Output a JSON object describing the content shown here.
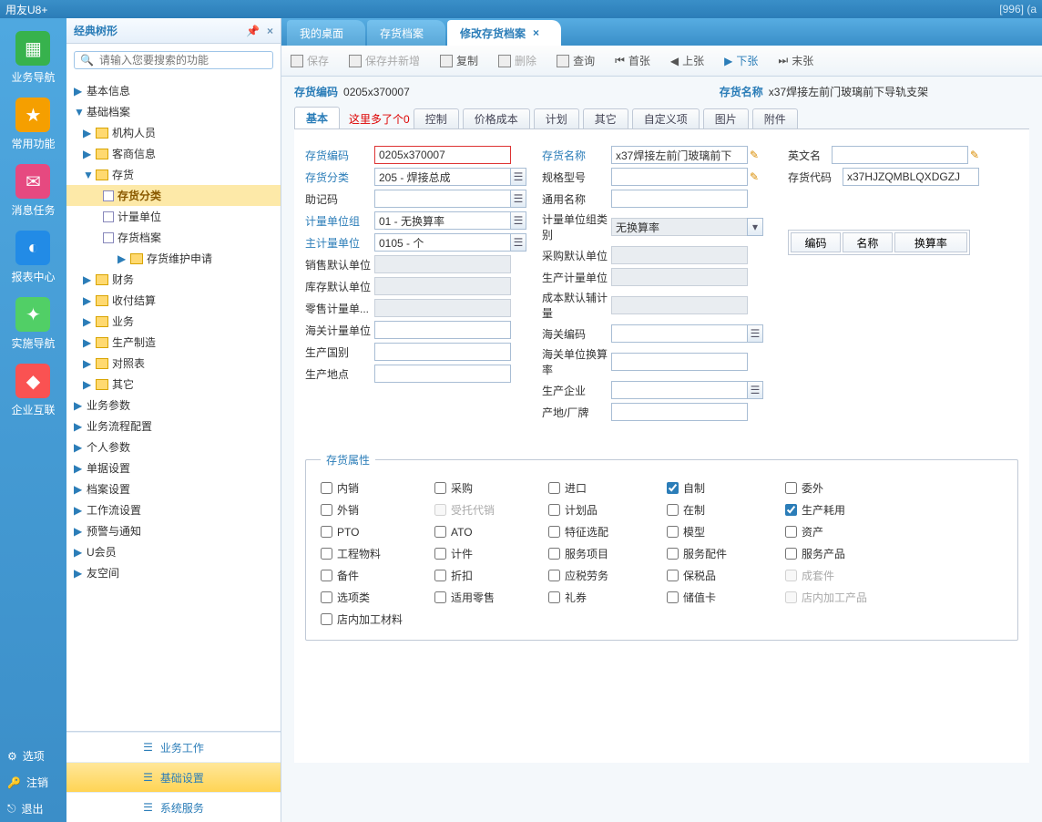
{
  "title_left": "用友U8+",
  "title_right": "[996] (a",
  "nav": [
    {
      "label": "业务导航",
      "icon": "▦"
    },
    {
      "label": "常用功能",
      "icon": "★"
    },
    {
      "label": "消息任务",
      "icon": "✉"
    },
    {
      "label": "报表中心",
      "icon": "◐"
    },
    {
      "label": "实施导航",
      "icon": "✦"
    },
    {
      "label": "企业互联",
      "icon": "◆"
    }
  ],
  "bottom_links": [
    {
      "label": "选项",
      "icon": "⚙"
    },
    {
      "label": "注销",
      "icon": "🔑"
    },
    {
      "label": "退出",
      "icon": "⎋"
    }
  ],
  "sidebar": {
    "header": "经典树形",
    "search_ph": "请输入您要搜索的功能",
    "items": [
      {
        "label": "基本信息",
        "lvl": 0,
        "arr": "▶"
      },
      {
        "label": "基础档案",
        "lvl": 0,
        "arr": "▼"
      },
      {
        "label": "机构人员",
        "lvl": 1,
        "arr": "▶"
      },
      {
        "label": "客商信息",
        "lvl": 1,
        "arr": "▶"
      },
      {
        "label": "存货",
        "lvl": 1,
        "arr": "▼"
      },
      {
        "label": "存货分类",
        "lvl": 2,
        "icon": "d",
        "sel": true
      },
      {
        "label": "计量单位",
        "lvl": 2,
        "icon": "d"
      },
      {
        "label": "存货档案",
        "lvl": 2,
        "icon": "d"
      },
      {
        "label": "存货维护申请",
        "lvl": 3,
        "arr": "▶"
      },
      {
        "label": "财务",
        "lvl": 1,
        "arr": "▶"
      },
      {
        "label": "收付结算",
        "lvl": 1,
        "arr": "▶"
      },
      {
        "label": "业务",
        "lvl": 1,
        "arr": "▶"
      },
      {
        "label": "生产制造",
        "lvl": 1,
        "arr": "▶"
      },
      {
        "label": "对照表",
        "lvl": 1,
        "arr": "▶"
      },
      {
        "label": "其它",
        "lvl": 1,
        "arr": "▶"
      },
      {
        "label": "业务参数",
        "lvl": 0,
        "arr": "▶"
      },
      {
        "label": "业务流程配置",
        "lvl": 0,
        "arr": "▶"
      },
      {
        "label": "个人参数",
        "lvl": 0,
        "arr": "▶"
      },
      {
        "label": "单据设置",
        "lvl": 0,
        "arr": "▶"
      },
      {
        "label": "档案设置",
        "lvl": 0,
        "arr": "▶"
      },
      {
        "label": "工作流设置",
        "lvl": 0,
        "arr": "▶"
      },
      {
        "label": "预警与通知",
        "lvl": 0,
        "arr": "▶"
      },
      {
        "label": "U会员",
        "lvl": 0,
        "arr": "▶"
      },
      {
        "label": "友空间",
        "lvl": 0,
        "arr": "▶"
      }
    ],
    "bottom_tabs": [
      {
        "label": "业务工作"
      },
      {
        "label": "基础设置",
        "active": true
      },
      {
        "label": "系统服务"
      }
    ]
  },
  "tabs": [
    {
      "label": "我的桌面"
    },
    {
      "label": "存货档案"
    },
    {
      "label": "修改存货档案",
      "active": true
    }
  ],
  "toolbar": [
    {
      "label": "保存",
      "dis": true
    },
    {
      "label": "保存并新增",
      "dis": true
    },
    {
      "label": "复制"
    },
    {
      "label": "删除",
      "dis": true
    },
    {
      "label": "查询"
    },
    {
      "label": "首张",
      "icon": "⏮"
    },
    {
      "label": "上张",
      "icon": "◀"
    },
    {
      "label": "下张",
      "icon": "▶",
      "hl": true
    },
    {
      "label": "末张",
      "icon": "⏭"
    }
  ],
  "info": {
    "code_lbl": "存货编码",
    "code": "0205x370007",
    "name_lbl": "存货名称",
    "name": "x37焊接左前门玻璃前下导轨支架"
  },
  "subtabs": [
    "基本",
    "控制",
    "价格成本",
    "计划",
    "其它",
    "自定义项",
    "图片",
    "附件"
  ],
  "annot": "这里多了个0",
  "form": {
    "left": [
      {
        "lbl": "存货编码",
        "val": "0205x370007",
        "blue": true,
        "hl": true
      },
      {
        "lbl": "存货分类",
        "val": "205 - 焊接总成",
        "blue": true,
        "btn": "☰"
      },
      {
        "lbl": "助记码",
        "val": "",
        "btn": "☰"
      },
      {
        "lbl": "计量单位组",
        "val": "01 - 无换算率",
        "blue": true,
        "btn": "☰"
      },
      {
        "lbl": "主计量单位",
        "val": "0105 - 个",
        "blue": true,
        "btn": "☰"
      },
      {
        "lbl": "销售默认单位",
        "val": "",
        "dis": true
      },
      {
        "lbl": "库存默认单位",
        "val": "",
        "dis": true
      },
      {
        "lbl": "零售计量单...",
        "val": "",
        "dis": true
      },
      {
        "lbl": "海关计量单位",
        "val": ""
      },
      {
        "lbl": "生产国别",
        "val": ""
      },
      {
        "lbl": "生产地点",
        "val": ""
      }
    ],
    "mid": [
      {
        "lbl": "存货名称",
        "val": "x37焊接左前门玻璃前下",
        "blue": true,
        "pencil": true
      },
      {
        "lbl": "规格型号",
        "val": "",
        "pencil": true
      },
      {
        "lbl": "通用名称",
        "val": ""
      },
      {
        "lbl": "计量单位组类别",
        "val": "无换算率",
        "dd": true,
        "dis": true
      },
      {
        "lbl": "采购默认单位",
        "val": "",
        "dis": true
      },
      {
        "lbl": "生产计量单位",
        "val": "",
        "dis": true
      },
      {
        "lbl": "成本默认辅计量",
        "val": "",
        "dis": true
      },
      {
        "lbl": "海关编码",
        "val": "",
        "btn": "☰"
      },
      {
        "lbl": "海关单位换算率",
        "val": ""
      },
      {
        "lbl": "生产企业",
        "val": "",
        "btn": "☰"
      },
      {
        "lbl": "产地/厂牌",
        "val": ""
      }
    ],
    "right": [
      {
        "lbl": "英文名",
        "val": "",
        "pencil": true
      },
      {
        "lbl": "存货代码",
        "val": "x37HJZQMBLQXDGZJ"
      }
    ]
  },
  "rtable": {
    "h": [
      "编码",
      "名称",
      "换算率"
    ]
  },
  "attrs": {
    "legend": "存货属性",
    "items": [
      [
        "内销",
        false,
        false
      ],
      [
        "采购",
        false,
        false
      ],
      [
        "进口",
        false,
        false
      ],
      [
        "自制",
        true,
        false
      ],
      [
        "委外",
        false,
        false
      ],
      [
        "外销",
        false,
        false
      ],
      [
        "受托代销",
        false,
        true
      ],
      [
        "计划品",
        false,
        false
      ],
      [
        "在制",
        false,
        false
      ],
      [
        "生产耗用",
        true,
        false
      ],
      [
        "PTO",
        false,
        false
      ],
      [
        "ATO",
        false,
        false
      ],
      [
        "特征选配",
        false,
        false
      ],
      [
        "模型",
        false,
        false
      ],
      [
        "资产",
        false,
        false
      ],
      [
        "工程物料",
        false,
        false
      ],
      [
        "计件",
        false,
        false
      ],
      [
        "服务项目",
        false,
        false
      ],
      [
        "服务配件",
        false,
        false
      ],
      [
        "服务产品",
        false,
        false
      ],
      [
        "备件",
        false,
        false
      ],
      [
        "折扣",
        false,
        false
      ],
      [
        "应税劳务",
        false,
        false
      ],
      [
        "保税品",
        false,
        false
      ],
      [
        "成套件",
        false,
        true
      ],
      [
        "选项类",
        false,
        false
      ],
      [
        "适用零售",
        false,
        false
      ],
      [
        "礼券",
        false,
        false
      ],
      [
        "储值卡",
        false,
        false
      ],
      [
        "店内加工产品",
        false,
        true
      ],
      [
        "店内加工材料",
        false,
        false
      ]
    ]
  }
}
